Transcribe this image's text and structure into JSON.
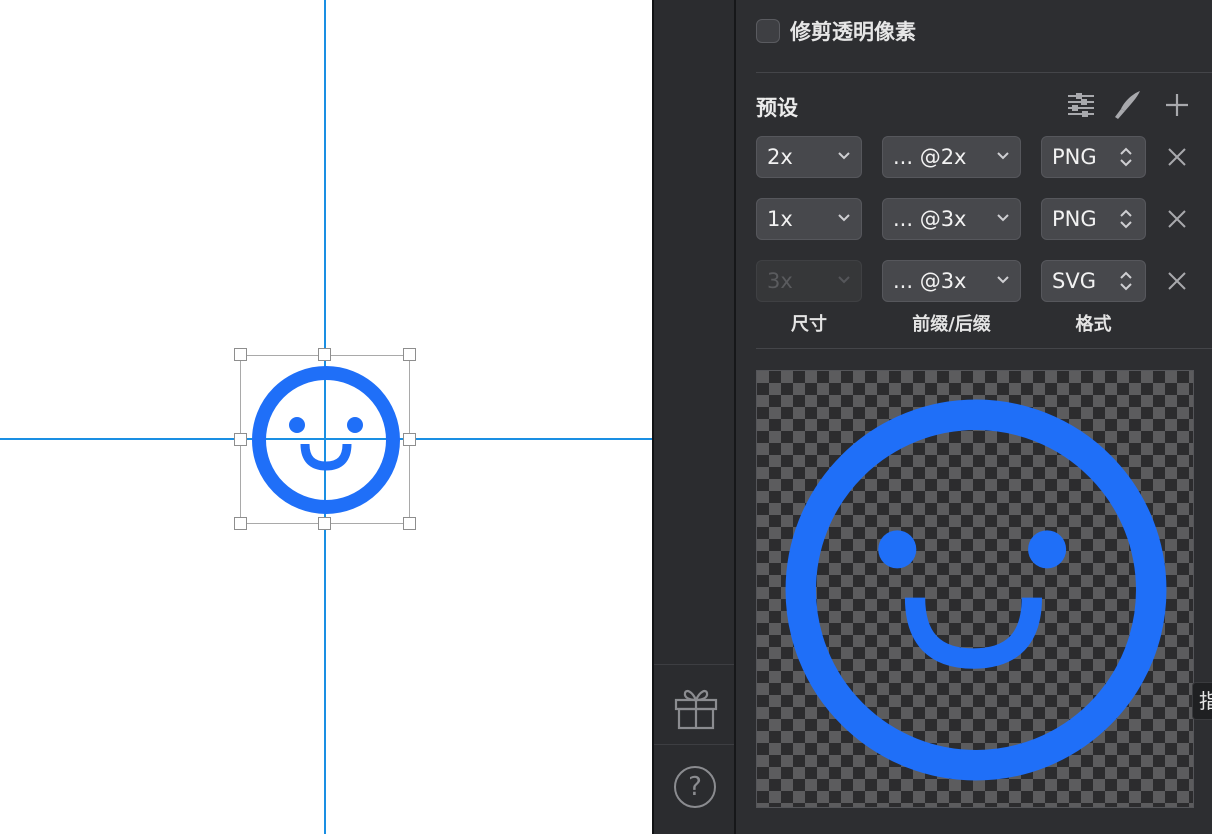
{
  "colors": {
    "accent_blue": "#1f6ff8",
    "guide_blue": "#1a8fe3",
    "panel_bg": "#2d2e31",
    "field_bg": "#47484c"
  },
  "canvas": {
    "artboard_icon": "smiley-face-icon"
  },
  "sidebar": {
    "gift_icon": "gift-icon",
    "help_label": "?"
  },
  "export_panel": {
    "trim_transparent_label": "修剪透明像素",
    "trim_transparent_checked": false,
    "presets_title": "预设",
    "toolbar_icons": [
      "sliders-icon",
      "knife-icon",
      "plus-icon"
    ],
    "rows": [
      {
        "size": "2x",
        "size_disabled": false,
        "suffix": "... @2x",
        "format": "PNG"
      },
      {
        "size": "1x",
        "size_disabled": false,
        "suffix": "... @3x",
        "format": "PNG"
      },
      {
        "size": "3x",
        "size_disabled": true,
        "suffix": "... @3x",
        "format": "SVG"
      }
    ],
    "column_labels": {
      "size": "尺寸",
      "suffix": "前缀/后缀",
      "format": "格式"
    },
    "tooltip_fragment": "指"
  }
}
